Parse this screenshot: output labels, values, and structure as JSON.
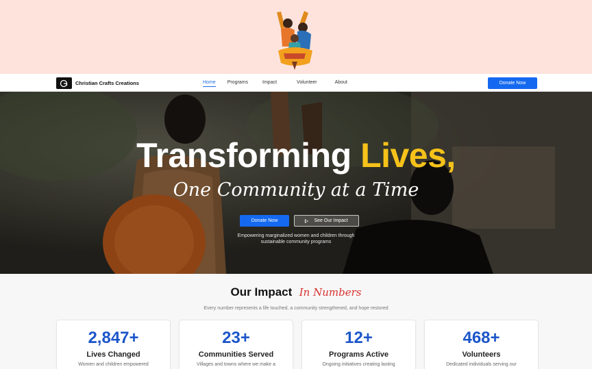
{
  "brand": {
    "name": "Christian Crafts Creations",
    "logo_glyph": "G"
  },
  "nav": {
    "items": [
      {
        "label": "Home",
        "active": true
      },
      {
        "label": "Programs",
        "active": false
      },
      {
        "label": "Impact",
        "active": false
      },
      {
        "label": "Volunteer",
        "active": false
      },
      {
        "label": "About",
        "active": false
      }
    ],
    "donate_label": "Donate Now"
  },
  "hero": {
    "title_main": "Transforming",
    "title_accent": "Lives,",
    "subtitle": "One Community at a Time",
    "donate_label": "Donate Now",
    "impact_label": "See Our Impact",
    "description": "Empowering marginalized women and children through sustainable community programs"
  },
  "impact": {
    "title_main": "Our Impact",
    "title_script": "In Numbers",
    "subtitle": "Every number represents a life touched, a community strengthened, and hope restored",
    "cards": [
      {
        "number": "2,847+",
        "label": "Lives Changed",
        "desc": "Women and children empowered"
      },
      {
        "number": "23+",
        "label": "Communities Served",
        "desc": "Villages and towns where we make a"
      },
      {
        "number": "12+",
        "label": "Programs Active",
        "desc": "Ongoing initiatives creating lasting"
      },
      {
        "number": "468+",
        "label": "Volunteers",
        "desc": "Dedicated individuals serving our"
      }
    ]
  },
  "colors": {
    "accent_blue": "#1569f0",
    "highlight_yellow": "#f6c21a",
    "script_red": "#d8312d",
    "top_band": "#fde3dc"
  }
}
